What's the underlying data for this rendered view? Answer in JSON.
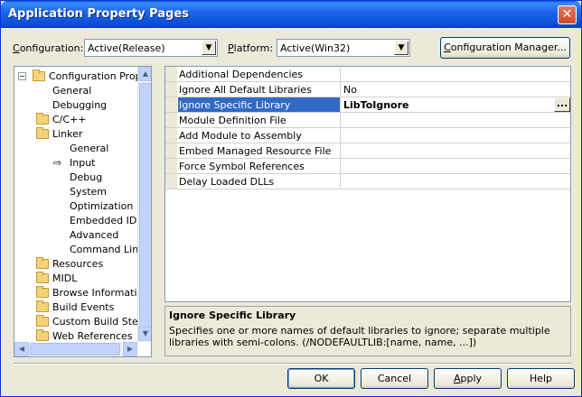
{
  "window": {
    "title": "Application Property Pages",
    "close_glyph": "✕"
  },
  "toolbar": {
    "configuration_label_prefix": "C",
    "configuration_label_rest": "onfiguration:",
    "configuration_value": "Active(Release)",
    "platform_label_prefix": "P",
    "platform_label_rest": "latform:",
    "platform_value": "Active(Win32)",
    "config_manager_prefix": "C",
    "config_manager_rest": "onfiguration Manager..."
  },
  "tree": {
    "items": [
      {
        "label": "Configuration Propertie",
        "level": 0,
        "expander": "−",
        "folder": true
      },
      {
        "label": "General",
        "level": 1
      },
      {
        "label": "Debugging",
        "level": 1
      },
      {
        "label": "C/C++",
        "level": 1,
        "expander": "+",
        "folder": true
      },
      {
        "label": "Linker",
        "level": 1,
        "expander": "−",
        "folder": true
      },
      {
        "label": "General",
        "level": 2
      },
      {
        "label": "Input",
        "level": 2,
        "current": true
      },
      {
        "label": "Debug",
        "level": 2
      },
      {
        "label": "System",
        "level": 2
      },
      {
        "label": "Optimization",
        "level": 2
      },
      {
        "label": "Embedded IDL",
        "level": 2
      },
      {
        "label": "Advanced",
        "level": 2
      },
      {
        "label": "Command Line",
        "level": 2
      },
      {
        "label": "Resources",
        "level": 1,
        "expander": "+",
        "folder": true
      },
      {
        "label": "MIDL",
        "level": 1,
        "expander": "+",
        "folder": true
      },
      {
        "label": "Browse Information",
        "level": 1,
        "expander": "+",
        "folder": true
      },
      {
        "label": "Build Events",
        "level": 1,
        "expander": "+",
        "folder": true
      },
      {
        "label": "Custom Build Step",
        "level": 1,
        "expander": "+",
        "folder": true
      },
      {
        "label": "Web References",
        "level": 1,
        "expander": "+",
        "folder": true
      }
    ],
    "current_arrow": "⇨",
    "scroll_up": "▲",
    "scroll_down": "▼",
    "scroll_left": "◀",
    "scroll_right": "▶"
  },
  "grid": {
    "rows": [
      {
        "name": "Additional Dependencies",
        "value": ""
      },
      {
        "name": "Ignore All Default Libraries",
        "value": "No"
      },
      {
        "name": "Ignore Specific Library",
        "value": "LibToIgnore",
        "selected": true
      },
      {
        "name": "Module Definition File",
        "value": ""
      },
      {
        "name": "Add Module to Assembly",
        "value": ""
      },
      {
        "name": "Embed Managed Resource File",
        "value": ""
      },
      {
        "name": "Force Symbol References",
        "value": ""
      },
      {
        "name": "Delay Loaded DLLs",
        "value": ""
      }
    ],
    "ellipsis": "..."
  },
  "description": {
    "title": "Ignore Specific Library",
    "body": "Specifies one or more names of default libraries to ignore; separate multiple libraries with semi-colons.     (/NODEFAULTLIB:[name, name, ...])"
  },
  "buttons": {
    "ok": "OK",
    "cancel": "Cancel",
    "apply_prefix": "A",
    "apply_rest": "pply",
    "help": "Help"
  }
}
